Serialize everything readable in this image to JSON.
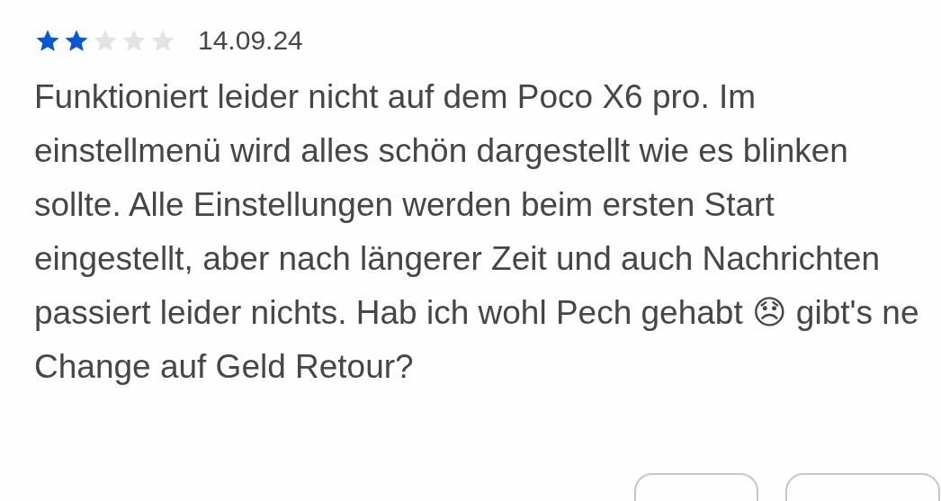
{
  "review": {
    "stars": 2,
    "date": "14.09.24",
    "text": "Funktioniert leider nicht auf dem Poco X6 pro. Im einstellmenü wird alles schön dargestellt wie es blinken sollte. Alle Einstellungen werden beim ersten Start eingestellt, aber nach längerer Zeit und auch Nachrichten passiert leider nichts. Hab ich wohl Pech gehabt 😞 gibt's ne Change auf Geld Retour?"
  }
}
